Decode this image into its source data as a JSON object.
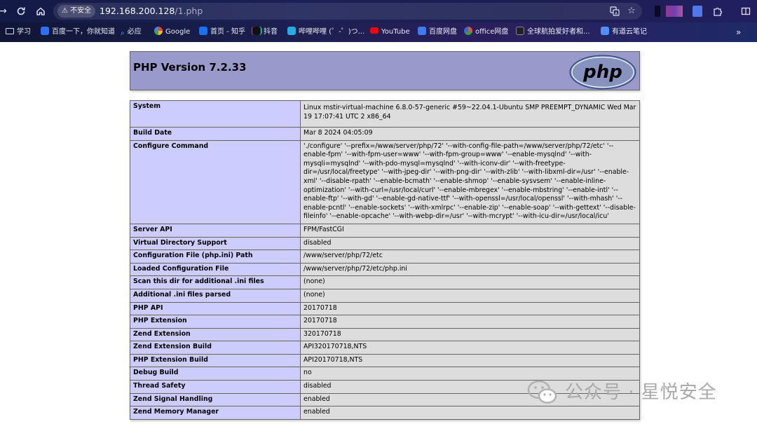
{
  "browser": {
    "security_label": "不安全",
    "url_host": "192.168.200.128",
    "url_path": "/1.php",
    "bookmarks": [
      {
        "label": "学习",
        "color": "#6d7aa8"
      },
      {
        "label": "百度一下，你就知道",
        "color": "#2d6ff7"
      },
      {
        "label": "必应",
        "color": "#3a8ee6"
      },
      {
        "label": "Google",
        "color": "#4285f4"
      },
      {
        "label": "首页 - 知乎",
        "color": "#1772f6"
      },
      {
        "label": "抖音",
        "color": "#111111"
      },
      {
        "label": "哔哩哔哩 (゜-゜)つ...",
        "color": "#23ade5"
      },
      {
        "label": "YouTube",
        "color": "#ff0000"
      },
      {
        "label": "百度网盘",
        "color": "#3b7cf6"
      },
      {
        "label": "office网盘",
        "color": "#e0543f"
      },
      {
        "label": "全球航拍爱好者和...",
        "color": "#222222"
      },
      {
        "label": "有道云笔记",
        "color": "#4f8ff7"
      }
    ]
  },
  "phpinfo": {
    "title": "PHP Version 7.2.33",
    "logo_text": "php",
    "rows": [
      {
        "key": "System",
        "value": "Linux mstir-virtual-machine 6.8.0-57-generic #59~22.04.1-Ubuntu SMP PREEMPT_DYNAMIC Wed Mar 19 17:07:41 UTC 2 x86_64"
      },
      {
        "key": "Build Date",
        "value": "Mar 8 2024 04:05:09"
      },
      {
        "key": "Configure Command",
        "value": "'./configure' '--prefix=/www/server/php/72' '--with-config-file-path=/www/server/php/72/etc' '--enable-fpm' '--with-fpm-user=www' '--with-fpm-group=www' '--enable-mysqlnd' '--with-mysqli=mysqlnd' '--with-pdo-mysql=mysqlnd' '--with-iconv-dir' '--with-freetype-dir=/usr/local/freetype' '--with-jpeg-dir' '--with-png-dir' '--with-zlib' '--with-libxml-dir=/usr' '--enable-xml' '--disable-rpath' '--enable-bcmath' '--enable-shmop' '--enable-sysvsem' '--enable-inline-optimization' '--with-curl=/usr/local/curl' '--enable-mbregex' '--enable-mbstring' '--enable-intl' '--enable-ftp' '--with-gd' '--enable-gd-native-ttf' '--with-openssl=/usr/local/openssl' '--with-mhash' '--enable-pcntl' '--enable-sockets' '--with-xmlrpc' '--enable-zip' '--enable-soap' '--with-gettext' '--disable-fileinfo' '--enable-opcache' '--with-webp-dir=/usr' '--with-mcrypt' '--with-icu-dir=/usr/local/icu'"
      },
      {
        "key": "Server API",
        "value": "FPM/FastCGI"
      },
      {
        "key": "Virtual Directory Support",
        "value": "disabled"
      },
      {
        "key": "Configuration File (php.ini) Path",
        "value": "/www/server/php/72/etc"
      },
      {
        "key": "Loaded Configuration File",
        "value": "/www/server/php/72/etc/php.ini"
      },
      {
        "key": "Scan this dir for additional .ini files",
        "value": "(none)"
      },
      {
        "key": "Additional .ini files parsed",
        "value": "(none)"
      },
      {
        "key": "PHP API",
        "value": "20170718"
      },
      {
        "key": "PHP Extension",
        "value": "20170718"
      },
      {
        "key": "Zend Extension",
        "value": "320170718"
      },
      {
        "key": "Zend Extension Build",
        "value": "API320170718,NTS"
      },
      {
        "key": "PHP Extension Build",
        "value": "API20170718,NTS"
      },
      {
        "key": "Debug Build",
        "value": "no"
      },
      {
        "key": "Thread Safety",
        "value": "disabled"
      },
      {
        "key": "Zend Signal Handling",
        "value": "enabled"
      },
      {
        "key": "Zend Memory Manager",
        "value": "enabled"
      }
    ]
  },
  "watermark": {
    "text": "公众号 · 星悦安全"
  }
}
